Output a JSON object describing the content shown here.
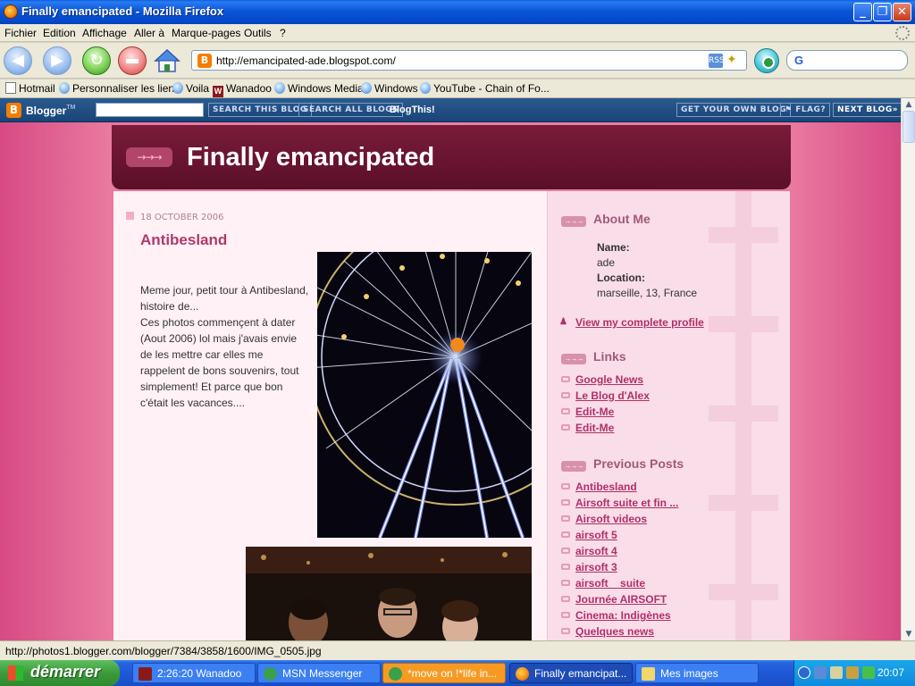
{
  "window": {
    "title": "Finally emancipated - Mozilla Firefox",
    "minimize": "_",
    "maximize": "❐",
    "close": "✕"
  },
  "menu": [
    "Fichier",
    "Edition",
    "Affichage",
    "Aller à",
    "Marque-pages",
    "Outils",
    "?"
  ],
  "navigation": {
    "url": "http://emancipated-ade.blogspot.com/",
    "search_engine_icon": "google-icon"
  },
  "bookmarks": [
    {
      "label": "Hotmail",
      "icon": "page-icon"
    },
    {
      "label": "Personnaliser les liens",
      "icon": "globe-icon"
    },
    {
      "label": "Voila",
      "icon": "globe-icon"
    },
    {
      "label": "Wanadoo",
      "icon": "wanadoo-icon"
    },
    {
      "label": "Windows Media",
      "icon": "globe-icon"
    },
    {
      "label": "Windows",
      "icon": "globe-icon"
    },
    {
      "label": "YouTube - Chain of Fo...",
      "icon": "globe-icon"
    }
  ],
  "blogger_bar": {
    "brand": "Blogger",
    "search_this_blog": "SEARCH THIS BLOG",
    "search_all_blogs": "SEARCH ALL BLOGS",
    "blogthis": "BlogThis!",
    "get_your_own": "GET YOUR OWN BLOG",
    "flag": "⚑ FLAG?",
    "next_blog": "NEXT BLOG»"
  },
  "blog": {
    "title": "Finally emancipated",
    "post": {
      "date": "18 OCTOBER 2006",
      "title": "Antibesland",
      "body": "Meme jour, petit tour à Antibesland, histoire de...\nCes photos commençent à dater (Aout 2006) lol mais j'avais envie de les mettre car elles me rappelent de bons souvenirs, tout simplement! Et parce que bon c'était les vacances...."
    },
    "sidebar": {
      "about_heading": "About Me",
      "name_label": "Name:",
      "name_value": "ade",
      "location_label": "Location:",
      "location_value": "marseille, 13, France",
      "profile_link": "View my complete profile",
      "links_heading": "Links",
      "links": [
        "Google News",
        "Le Blog d'Alex",
        "Edit-Me",
        "Edit-Me"
      ],
      "previous_heading": "Previous Posts",
      "previous": [
        "Antibesland",
        "Airsoft suite et fin ...",
        "Airsoft videos",
        "airsoft 5",
        "airsoft 4",
        "airsoft 3",
        "airsoft _ suite",
        "Journée AIRSOFT",
        "Cinema: Indigènes",
        "Quelques news"
      ]
    },
    "colors": {
      "page_background": "#e783a8",
      "header_background": "#6a1530",
      "link": "#b0306a",
      "post_title": "#b03a68"
    }
  },
  "status": {
    "text": "http://photos1.blogger.com/blogger/7384/3858/1600/IMG_0505.jpg"
  },
  "taskbar": {
    "start_label": "démarrer",
    "tasks": [
      {
        "label": "2:26:20 Wanadoo",
        "state": "normal"
      },
      {
        "label": "MSN Messenger",
        "state": "normal"
      },
      {
        "label": "*move on !*life in...",
        "state": "flashing"
      },
      {
        "label": "Finally emancipat...",
        "state": "active"
      },
      {
        "label": "Mes images",
        "state": "normal"
      }
    ],
    "clock": "20:07"
  }
}
